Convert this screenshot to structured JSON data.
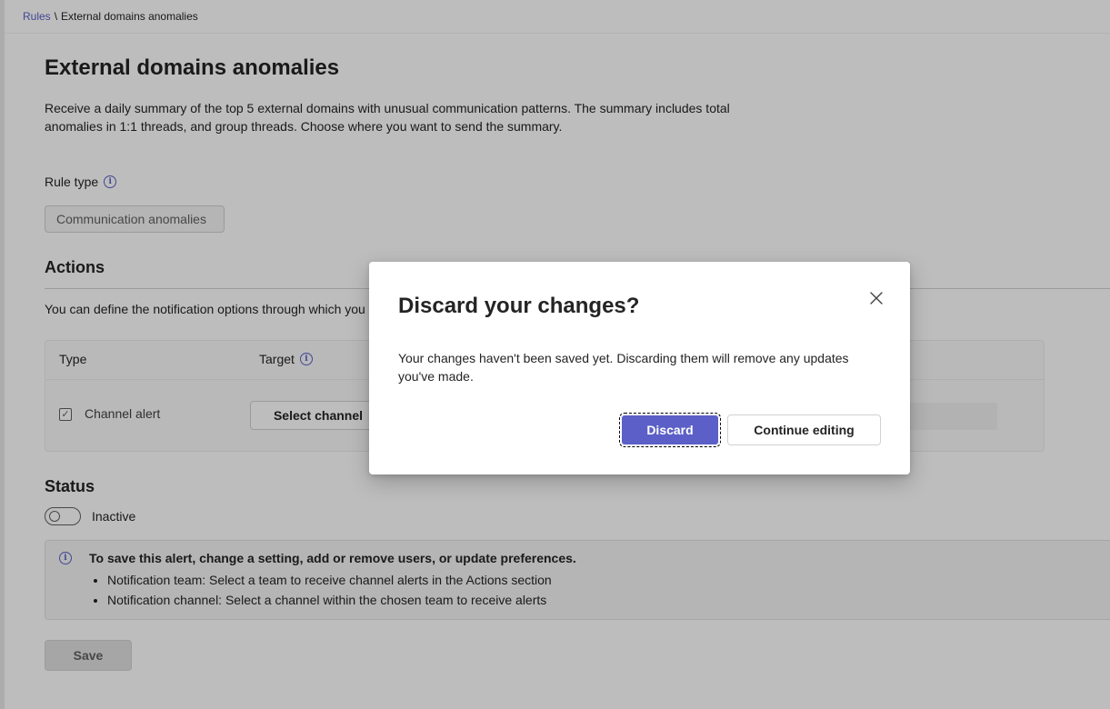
{
  "breadcrumb": {
    "root": "Rules",
    "separator": "\\",
    "current": "External domains anomalies"
  },
  "page": {
    "title": "External domains anomalies",
    "description": "Receive a daily summary of the top 5 external domains with unusual communication patterns. The summary includes total anomalies in 1:1 threads, and group threads. Choose where you want to send the summary."
  },
  "rule_type": {
    "label": "Rule type",
    "value": "Communication anomalies"
  },
  "actions": {
    "title": "Actions",
    "description": "You can define the notification options through which you",
    "table": {
      "col_type": "Type",
      "col_target": "Target",
      "rows": [
        {
          "checked": true,
          "type": "Channel alert",
          "target_button": "Select channel"
        }
      ]
    }
  },
  "status": {
    "title": "Status",
    "toggle_on": false,
    "toggle_label": "Inactive"
  },
  "info_banner": {
    "title": "To save this alert, change a setting, add or remove users, or update preferences.",
    "items": [
      "Notification team: Select a team to receive channel alerts in the Actions section",
      "Notification channel: Select a channel within the chosen team to receive alerts"
    ]
  },
  "save_label": "Save",
  "dialog": {
    "title": "Discard your changes?",
    "body": "Your changes haven't been saved yet. Discarding them will remove any updates you've made.",
    "primary_label": "Discard",
    "secondary_label": "Continue editing"
  },
  "colors": {
    "accent": "#5b5fc7",
    "overlay": "rgba(0,0,0,0.26)"
  },
  "icons": {
    "info": "info-icon",
    "close": "close-icon",
    "check": "checkmark-icon"
  }
}
